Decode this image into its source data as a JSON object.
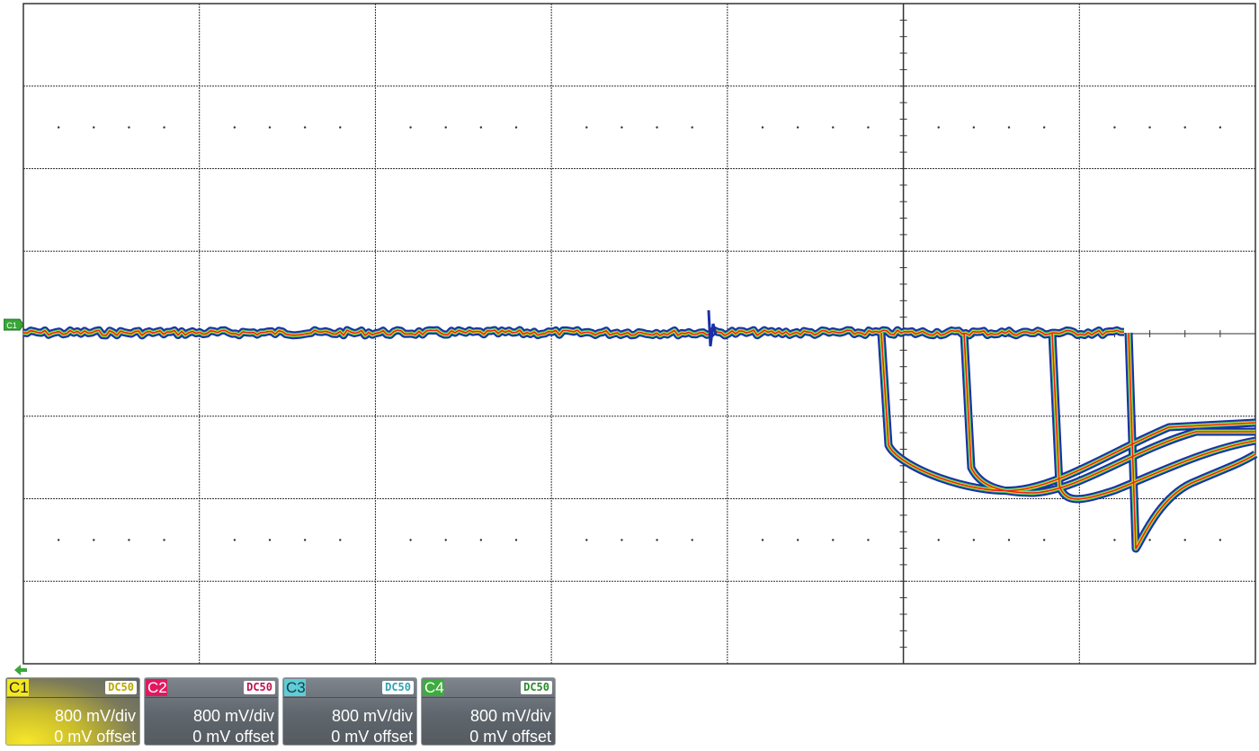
{
  "channels": [
    {
      "id": "C1",
      "coupling": "DC50",
      "scale": "800 mV/div",
      "offset": "0 mV offset",
      "color": "#f4e61f",
      "active": true
    },
    {
      "id": "C2",
      "coupling": "DC50",
      "scale": "800 mV/div",
      "offset": "0 mV offset",
      "color": "#e0195f",
      "active": false
    },
    {
      "id": "C3",
      "coupling": "DC50",
      "scale": "800 mV/div",
      "offset": "0 mV offset",
      "color": "#5ecdd8",
      "active": false
    },
    {
      "id": "C4",
      "coupling": "DC50",
      "scale": "800 mV/div",
      "offset": "0 mV offset",
      "color": "#3dab3d",
      "active": false
    }
  ],
  "trace_marker": {
    "label": "C1",
    "color": "#3aa63a"
  },
  "trigger_marker": {
    "color": "#3aa63a"
  },
  "colors": {
    "grid": "#333333",
    "trace_core": "#e8221a",
    "trace_mid": "#f4e61f",
    "trace_halo": "#1a2fa8"
  }
}
